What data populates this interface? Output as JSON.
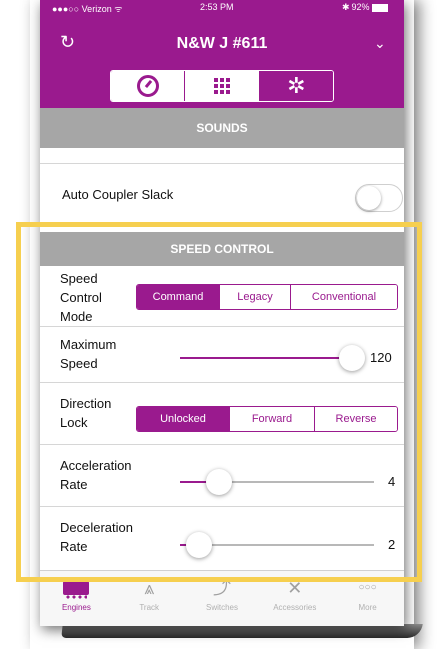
{
  "status": {
    "carrier": "●●●○○ Verizon ᯤ",
    "time": "2:53 PM",
    "battery": "92%"
  },
  "header": {
    "title": "N&W J #611"
  },
  "top_tabs": [
    {
      "name": "dial-icon"
    },
    {
      "name": "grid-icon"
    },
    {
      "name": "gear-icon",
      "active": true
    }
  ],
  "sections": {
    "sounds": "SOUNDS",
    "speed_control": "SPEED CONTROL"
  },
  "auto_coupler": {
    "label": "Auto Coupler Slack",
    "on": false
  },
  "speed_mode": {
    "label": "Speed\nControl\nMode",
    "options": [
      "Command",
      "Legacy",
      "Conventional"
    ],
    "selected": "Command"
  },
  "max_speed": {
    "label": "Maximum\nSpeed",
    "value": "120",
    "level": 1.0
  },
  "direction_lock": {
    "label": "Direction\nLock",
    "options": [
      "Unlocked",
      "Forward",
      "Reverse"
    ],
    "selected": "Unlocked"
  },
  "acceleration": {
    "label": "Acceleration\nRate",
    "value": "4",
    "level": 0.2
  },
  "deceleration": {
    "label": "Deceleration\nRate",
    "value": "2",
    "level": 0.1
  },
  "tabbar": [
    {
      "label": "Engines",
      "icon": "train-icon",
      "active": true
    },
    {
      "label": "Track",
      "icon": "track-icon"
    },
    {
      "label": "Switches",
      "icon": "switch-icon"
    },
    {
      "label": "Accessories",
      "icon": "accessory-icon"
    },
    {
      "label": "More",
      "icon": "more-icon"
    }
  ],
  "colors": {
    "accent": "#9a1a8e",
    "section_bar": "#a6a6a6",
    "highlight": "#f6cf4f"
  }
}
